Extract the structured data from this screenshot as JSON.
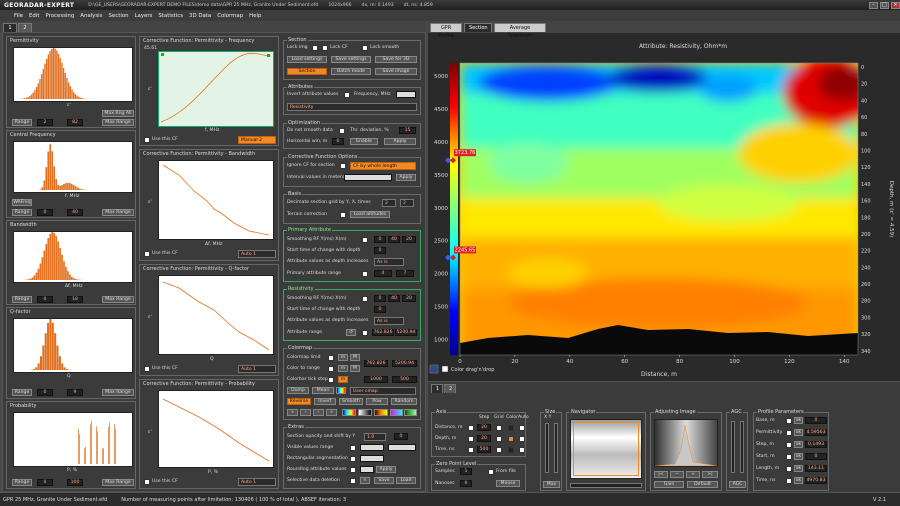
{
  "window": {
    "logo": "GEORADAR-EXPERT",
    "path": "D:\\GE_USERS\\GEORADAR-EXPERT DEMO FILES\\demo data\\GPR 25 MHz, Granite Under Sediment.efd",
    "size": "1024x966",
    "dx": "dx, m: 0.1493",
    "dt": "dt, ns: 4.859"
  },
  "menu": [
    "File",
    "Edit",
    "Processing",
    "Analysis",
    "Section",
    "Layers",
    "Statistics",
    "3D Data",
    "Colormap",
    "Help"
  ],
  "left_tabs": [
    "1",
    "2"
  ],
  "hist": {
    "permittivity": {
      "title": "Permittivity",
      "xlabel": "ε'",
      "range_label": "Range",
      "v1": "2",
      "v2": "82",
      "btn2": "Max Range",
      "extra": "Max Rng All"
    },
    "central": {
      "title": "Central Frequency",
      "xlabel": "f, MHz",
      "range_label": "Range",
      "v1": "0",
      "v2": "40",
      "btn2": "Max Range",
      "extra": "WAFreq"
    },
    "bandwidth": {
      "title": "Bandwidth",
      "xlabel": "Δf, MHz",
      "range_label": "Range",
      "v1": "0",
      "v2": "18",
      "btn2": "Max Range"
    },
    "qfactor": {
      "title": "Q-factor",
      "xlabel": "Q",
      "range_label": "Range",
      "v1": "0",
      "v2": "9",
      "btn2": "Max Range"
    },
    "probability": {
      "title": "Probability",
      "xlabel": "P, %",
      "range_label": "Range",
      "v1": "0",
      "v2": "100",
      "btn2": "Max Range"
    }
  },
  "cf": {
    "freq": {
      "title": "Corrective Function: Permittivity - Frequency",
      "top": "45.61",
      "use": "Use this CF",
      "mode": "Manual 2",
      "xlabel": "f, MHz",
      "ylabel": "ε'"
    },
    "bw": {
      "title": "Corrective Function: Permittivity - Bandwidth",
      "use": "Use this CF",
      "mode": "Auto 1",
      "xlabel": "Δf, MHz",
      "ylabel": "ε'"
    },
    "q": {
      "title": "Corrective Function: Permittivity - Q-factor",
      "use": "Use this CF",
      "mode": "Auto 1",
      "xlabel": "Q",
      "ylabel": "ε'"
    },
    "prob": {
      "title": "Corrective Function: Permittivity - Probability",
      "use": "Use this CF",
      "mode": "Auto 1",
      "xlabel": "P, %",
      "ylabel": "ε'"
    }
  },
  "section": {
    "title": "Section",
    "lock_img": "Lock img",
    "lock_cf": "Lock CF",
    "lock_smooth": "Lock smooth",
    "load_settings": "Load settings",
    "save_settings": "Save settings",
    "save_3d": "Save for 3D",
    "section_btn": "Section",
    "batch": "Batch mode",
    "save_image": "Save image",
    "attributes": "Attributes",
    "invert": "Invert attribute values",
    "freq_label": "Frequency, MHz",
    "attr_sel": "Resistivity",
    "optimization": "Optimization",
    "no_smooth": "Do not smooth data",
    "thr": "Thr. deviation, %",
    "thr_val": "15",
    "horiz": "Horizontal win, m",
    "horiz_val": "0",
    "enable": "Enable",
    "apply": "Apply",
    "cfo": "Corrective Function Options",
    "ignore_cf": "Ignore CF for section",
    "cf_by": "CF by whole length",
    "interval": "Interval values in meters",
    "basis": "Basis",
    "decimate": "Decimate section grid by Y, X, times",
    "dec_y": "2",
    "dec_x": "2",
    "terrain": "Terrain correction",
    "load_alt": "Load altitudes",
    "primary": "Primary Attribute",
    "smooth_rf": "Smoothing  RF  Y(ms)  X(m)",
    "p_v1": "0",
    "p_v2": "40",
    "p_v3": "20",
    "start_time": "Start time of change with depth",
    "st_val": "0",
    "as_depth": "Attribute values as depth increases",
    "as_is": "As is",
    "pa_range": "Primary attribute range",
    "pr_v1": "4",
    "pr_v2": "7",
    "resistivity": "Resistivity",
    "r_v1": "0",
    "r_v2": "40",
    "r_v3": "20",
    "r_st": "0",
    "r_asis": "As is",
    "attr_range": "Attribute range",
    "ar_v1": "762.826",
    "ar_v2": "5200.94",
    "colormap": "Colormap",
    "cm_limit": "Colormap limit",
    "cm_range": "Color to range",
    "cm_l1": "762.826",
    "cm_l2": "5200.94",
    "cb_tick": "Colorbar tick step",
    "cb_v1": "1000",
    "cb_v2": "500",
    "dump": "Dump",
    "mean": "Mean",
    "user_cmap": "User cmap",
    "reverse": "Reverse",
    "invert_btn": "Invert",
    "smooth": "Smooth",
    "pow": "Pow",
    "random": "Random",
    "extras": "Extras",
    "opacity": "Section opacity and shift by Y",
    "op_v": "1.0",
    "op_v2": "0",
    "visible_range": "Visible values range",
    "rect_seg": "Rectangular segmentation",
    "rounding": "Rounding attribute values",
    "sel_del": "Selective data deletion",
    "save": "Save",
    "load": "Load"
  },
  "right_tabs": [
    "GPR Profile",
    "Section",
    "Average Spectrum"
  ],
  "chart_data": {
    "type": "heatmap",
    "title": "Attribute: Resistivity, Ohm*m",
    "xlabel": "Distance, m",
    "ylabel": "Depth, m (ε' = 4.59)",
    "xticks": [
      "0",
      "20",
      "40",
      "60",
      "80",
      "100",
      "120",
      "140"
    ],
    "yticks_left": [
      "5000",
      "4500",
      "4000",
      "3500",
      "3000",
      "2500",
      "2000",
      "1500",
      "1000"
    ],
    "yticks_right": [
      "0",
      "20",
      "40",
      "60",
      "80",
      "100",
      "120",
      "140",
      "160",
      "180",
      "200",
      "220",
      "240",
      "260",
      "280",
      "300",
      "320",
      "340"
    ],
    "xlim": [
      0,
      145
    ],
    "markers": [
      {
        "label": "3723.76",
        "value": 3723.76
      },
      {
        "label": "2245.65",
        "value": 2245.65
      }
    ],
    "colormap": "jet",
    "color_drag": "Color drag'n'drop"
  },
  "bottom": {
    "tabs": [
      "1",
      "2"
    ],
    "axis": "Axis",
    "step": "Step",
    "grid": "Grid",
    "color": "Color",
    "autos": "Auto",
    "dist": "Distance, m",
    "dist_v": "20",
    "depth": "Depth, m",
    "depth_v": "20",
    "time": "Time, ns",
    "time_v": "500",
    "zero": "Zero Point Level",
    "samples": "Samples",
    "samples_v": "1",
    "nanosec": "Nanosec",
    "nanosec_v": "0",
    "from_file": "From file",
    "mouse": "Mouse",
    "size": "Size",
    "xy": "X  Y",
    "max": "Max",
    "navigator": "Navigator",
    "adjusting": "Adjusting Image",
    "gain": "Gain",
    "default": "Default",
    "agc": "AGC",
    "agc_btn": "AGC",
    "profile": "Profile Parameters",
    "base": "Base, m",
    "base_v": "0",
    "perm": "Permittivity",
    "perm_v": "4.59563",
    "stepm": "Step, m",
    "step_v": "0.1493",
    "start": "Start, m",
    "start_v": "0",
    "length": "Length, m",
    "length_v": "143.11",
    "timens": "Time, ns",
    "timens_v": "4970.83"
  },
  "status": {
    "file": "GPR 25 MHz, Granite Under Sediment.efd",
    "points": "Number of measuring points after limitation: 130406  ( 100 % of total ),  ABSEF iteration: 3",
    "version": "V 2.1"
  }
}
